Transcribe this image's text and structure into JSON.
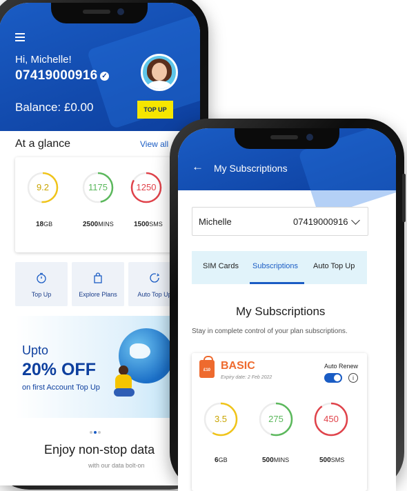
{
  "home": {
    "greeting": "Hi, Michelle!",
    "phone_number": "07419000916",
    "balance": "Balance: £0.00",
    "top_up_button": "TOP UP",
    "glance_title": "At a glance",
    "view_all": "View all",
    "usage": [
      {
        "value": "9.2",
        "total": "18",
        "unit": "GB",
        "color": "#f0c419"
      },
      {
        "value": "1175",
        "total": "2500",
        "unit": "MINS",
        "color": "#5bb85c"
      },
      {
        "value": "1250",
        "total": "1500",
        "unit": "SMS",
        "color": "#e0424a"
      }
    ],
    "quick_actions": [
      {
        "label": "Top Up",
        "icon": "stopwatch-icon"
      },
      {
        "label": "Explore Plans",
        "icon": "shopping-bag-icon"
      },
      {
        "label": "Auto Top Up",
        "icon": "auto-topup-icon"
      }
    ],
    "promo": {
      "upto": "Upto",
      "headline": "20% OFF",
      "subtext": "on first Account Top Up"
    },
    "enjoy_title": "Enjoy non-stop data",
    "enjoy_subtitle": "with our data bolt-on"
  },
  "subscriptions": {
    "title": "My Subscriptions",
    "selector": {
      "name": "Michelle",
      "number": "07419000916"
    },
    "tabs": [
      {
        "label": "SIM Cards",
        "active": false
      },
      {
        "label": "Subscriptions",
        "active": true
      },
      {
        "label": "Auto Top Up",
        "active": false
      }
    ],
    "section_title": "My Subscriptions",
    "section_desc": "Stay in complete control of your plan subscriptions.",
    "plan": {
      "price_tag": "£10",
      "name": "BASIC",
      "expiry": "Expiry date: 2 Feb 2022",
      "auto_renew_label": "Auto Renew",
      "auto_renew_on": true,
      "usage": [
        {
          "value": "3.5",
          "total": "6",
          "unit": "GB",
          "color": "#f0c419"
        },
        {
          "value": "275",
          "total": "500",
          "unit": "MINS",
          "color": "#5bb85c"
        },
        {
          "value": "450",
          "total": "500",
          "unit": "SMS",
          "color": "#e0424a"
        }
      ]
    }
  },
  "colors": {
    "brand_blue": "#1a5cc4",
    "accent_yellow": "#f5e600",
    "plan_orange": "#ee6a2e"
  }
}
